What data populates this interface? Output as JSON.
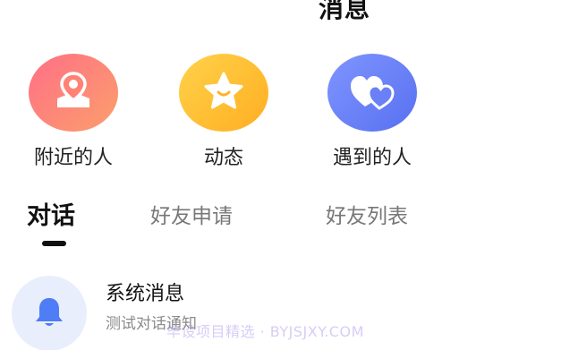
{
  "header": {
    "title": "消息"
  },
  "shortcuts": [
    {
      "label": "附近的人",
      "icon": "location-pin-icon",
      "colors": [
        "#ff6f7e",
        "#fba36c"
      ]
    },
    {
      "label": "动态",
      "icon": "star-icon",
      "colors": [
        "#ffc93d",
        "#ffb326"
      ]
    },
    {
      "label": "遇到的人",
      "icon": "hearts-icon",
      "colors": [
        "#7b90ff",
        "#5a72f2"
      ]
    }
  ],
  "tabs": [
    {
      "label": "对话",
      "active": true
    },
    {
      "label": "好友申请",
      "active": false
    },
    {
      "label": "好友列表",
      "active": false
    }
  ],
  "messages": [
    {
      "title": "系统消息",
      "preview": "测试对话通知",
      "icon": "bell-icon"
    }
  ],
  "watermark": "毕设项目精选 · BYJSJXY.COM"
}
